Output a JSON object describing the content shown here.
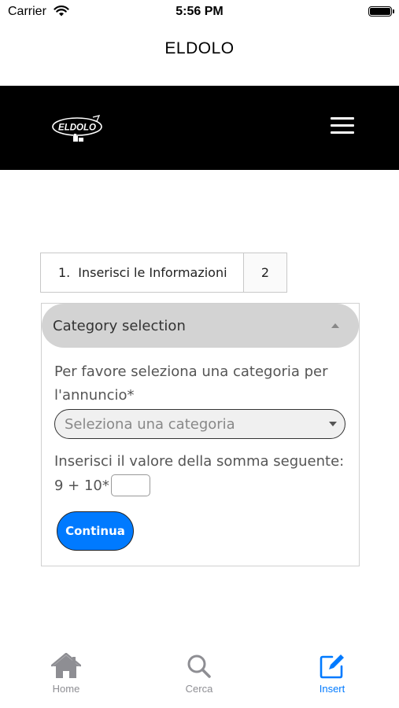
{
  "status_bar": {
    "carrier": "Carrier",
    "time": "5:56 PM"
  },
  "nav": {
    "title": "ELDOLO"
  },
  "header": {
    "logo_text": "ELDOLO",
    "menu_icon": "hamburger-menu-icon"
  },
  "steps": [
    {
      "number": "1.",
      "label": "Inserisci le Informazioni"
    },
    {
      "number": "2",
      "label": ""
    }
  ],
  "accordion": {
    "title": "Category selection",
    "category_label": "Per favore seleziona una categoria per l'annuncio",
    "required_mark": "*",
    "category_placeholder": "Seleziona una categoria",
    "sum_label": "Inserisci il valore della somma seguente:",
    "sum_expression": "9 + 10",
    "continue_label": "Continua"
  },
  "tab_bar": {
    "items": [
      {
        "label": "Home",
        "icon": "home-icon",
        "active": false
      },
      {
        "label": "Cerca",
        "icon": "search-icon",
        "active": false
      },
      {
        "label": "Insert",
        "icon": "compose-icon",
        "active": true
      }
    ]
  },
  "colors": {
    "accent": "#007aff",
    "header_bg": "#000000",
    "inactive_tab": "#8e8e93",
    "accordion_bg": "#d3d3d3"
  }
}
